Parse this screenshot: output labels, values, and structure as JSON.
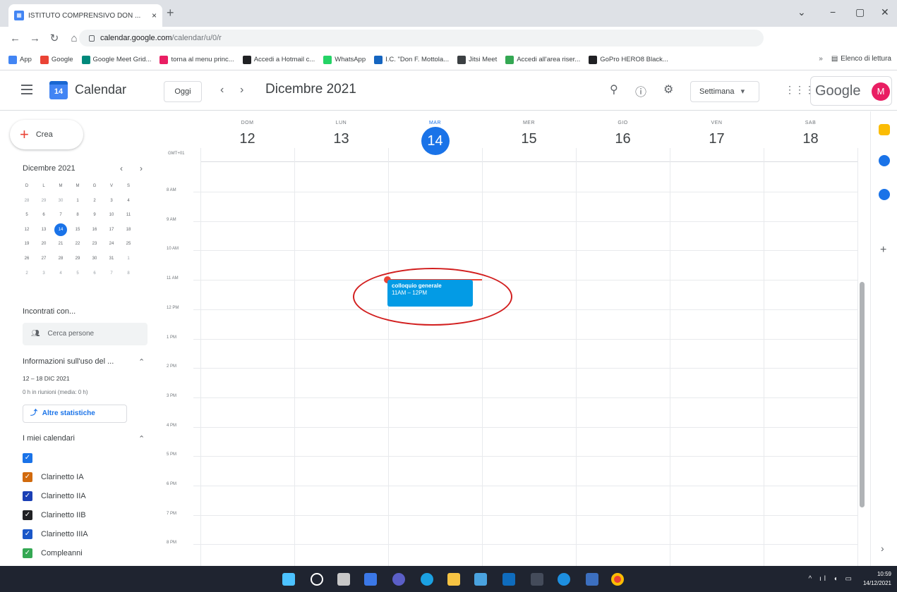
{
  "browser": {
    "tab_title": "ISTITUTO COMPRENSIVO DON ...",
    "tab_close": "×",
    "new_tab": "+",
    "url_host": "calendar.google.com",
    "url_path": "/calendar/u/0/r",
    "profile_initial": "M",
    "bookmarks": [
      {
        "label": "App",
        "color": "#4285f4"
      },
      {
        "label": "Google",
        "color": "#ea4335"
      },
      {
        "label": "Google Meet Grid...",
        "color": "#00897b"
      },
      {
        "label": "torna al menu princ...",
        "color": "#e91e63"
      },
      {
        "label": "Accedi a Hotmail c...",
        "color": "#202124"
      },
      {
        "label": "WhatsApp",
        "color": "#25d366"
      },
      {
        "label": "I.C. \"Don F. Mottola...",
        "color": "#1565c0"
      },
      {
        "label": "Jitsi Meet",
        "color": "#3c4043"
      },
      {
        "label": "Accedi all'area riser...",
        "color": "#34a853"
      },
      {
        "label": "GoPro HERO8 Black...",
        "color": "#202124"
      }
    ],
    "reading_list": "Elenco di lettura"
  },
  "header": {
    "app_name": "Calendar",
    "logo_day": "14",
    "today_label": "Oggi",
    "month_title": "Dicembre 2021",
    "view_label": "Settimana",
    "google_label": "Google",
    "avatar_initial": "M"
  },
  "sidebar": {
    "create_label": "Crea",
    "mini_month": "Dicembre 2021",
    "weekday_initials": [
      "D",
      "L",
      "M",
      "M",
      "G",
      "V",
      "S"
    ],
    "mini_days": [
      [
        "28",
        "29",
        "30",
        "1",
        "2",
        "3",
        "4"
      ],
      [
        "5",
        "6",
        "7",
        "8",
        "9",
        "10",
        "11"
      ],
      [
        "12",
        "13",
        "14",
        "15",
        "16",
        "17",
        "18"
      ],
      [
        "19",
        "20",
        "21",
        "22",
        "23",
        "24",
        "25"
      ],
      [
        "26",
        "27",
        "28",
        "29",
        "30",
        "31",
        "1"
      ],
      [
        "2",
        "3",
        "4",
        "5",
        "6",
        "7",
        "8"
      ]
    ],
    "meet_with_label": "Incontrati con...",
    "search_people_placeholder": "Cerca persone",
    "usage_label": "Informazioni sull'uso del ...",
    "usage_range": "12 – 18 DIC 2021",
    "usage_detail": "0 h in riunioni (media: 0 h)",
    "more_stats_label": "Altre statistiche",
    "my_calendars_label": "I miei calendari",
    "calendars": [
      {
        "name": "",
        "color": "#1a73e8"
      },
      {
        "name": "Clarinetto IA",
        "color": "#d16a0d"
      },
      {
        "name": "Clarinetto IIA",
        "color": "#1a3fb5"
      },
      {
        "name": "Clarinetto IIB",
        "color": "#202124"
      },
      {
        "name": "Clarinetto IIIA",
        "color": "#1a57c8"
      },
      {
        "name": "Compleanni",
        "color": "#34a853"
      }
    ]
  },
  "week": {
    "timezone": "GMT+01",
    "days": [
      {
        "name": "DOM",
        "date": "12"
      },
      {
        "name": "LUN",
        "date": "13"
      },
      {
        "name": "MAR",
        "date": "14"
      },
      {
        "name": "MER",
        "date": "15"
      },
      {
        "name": "GIO",
        "date": "16"
      },
      {
        "name": "VEN",
        "date": "17"
      },
      {
        "name": "SAB",
        "date": "18"
      }
    ],
    "hours": [
      "8 AM",
      "9 AM",
      "10 AM",
      "11 AM",
      "12 PM",
      "1 PM",
      "2 PM",
      "3 PM",
      "4 PM",
      "5 PM",
      "6 PM",
      "7 PM",
      "8 PM"
    ],
    "event": {
      "title": "colloquio generale",
      "time": "11AM – 12PM",
      "color": "#039be5"
    }
  },
  "taskbar": {
    "time": "10:59",
    "date": "14/12/2021"
  }
}
